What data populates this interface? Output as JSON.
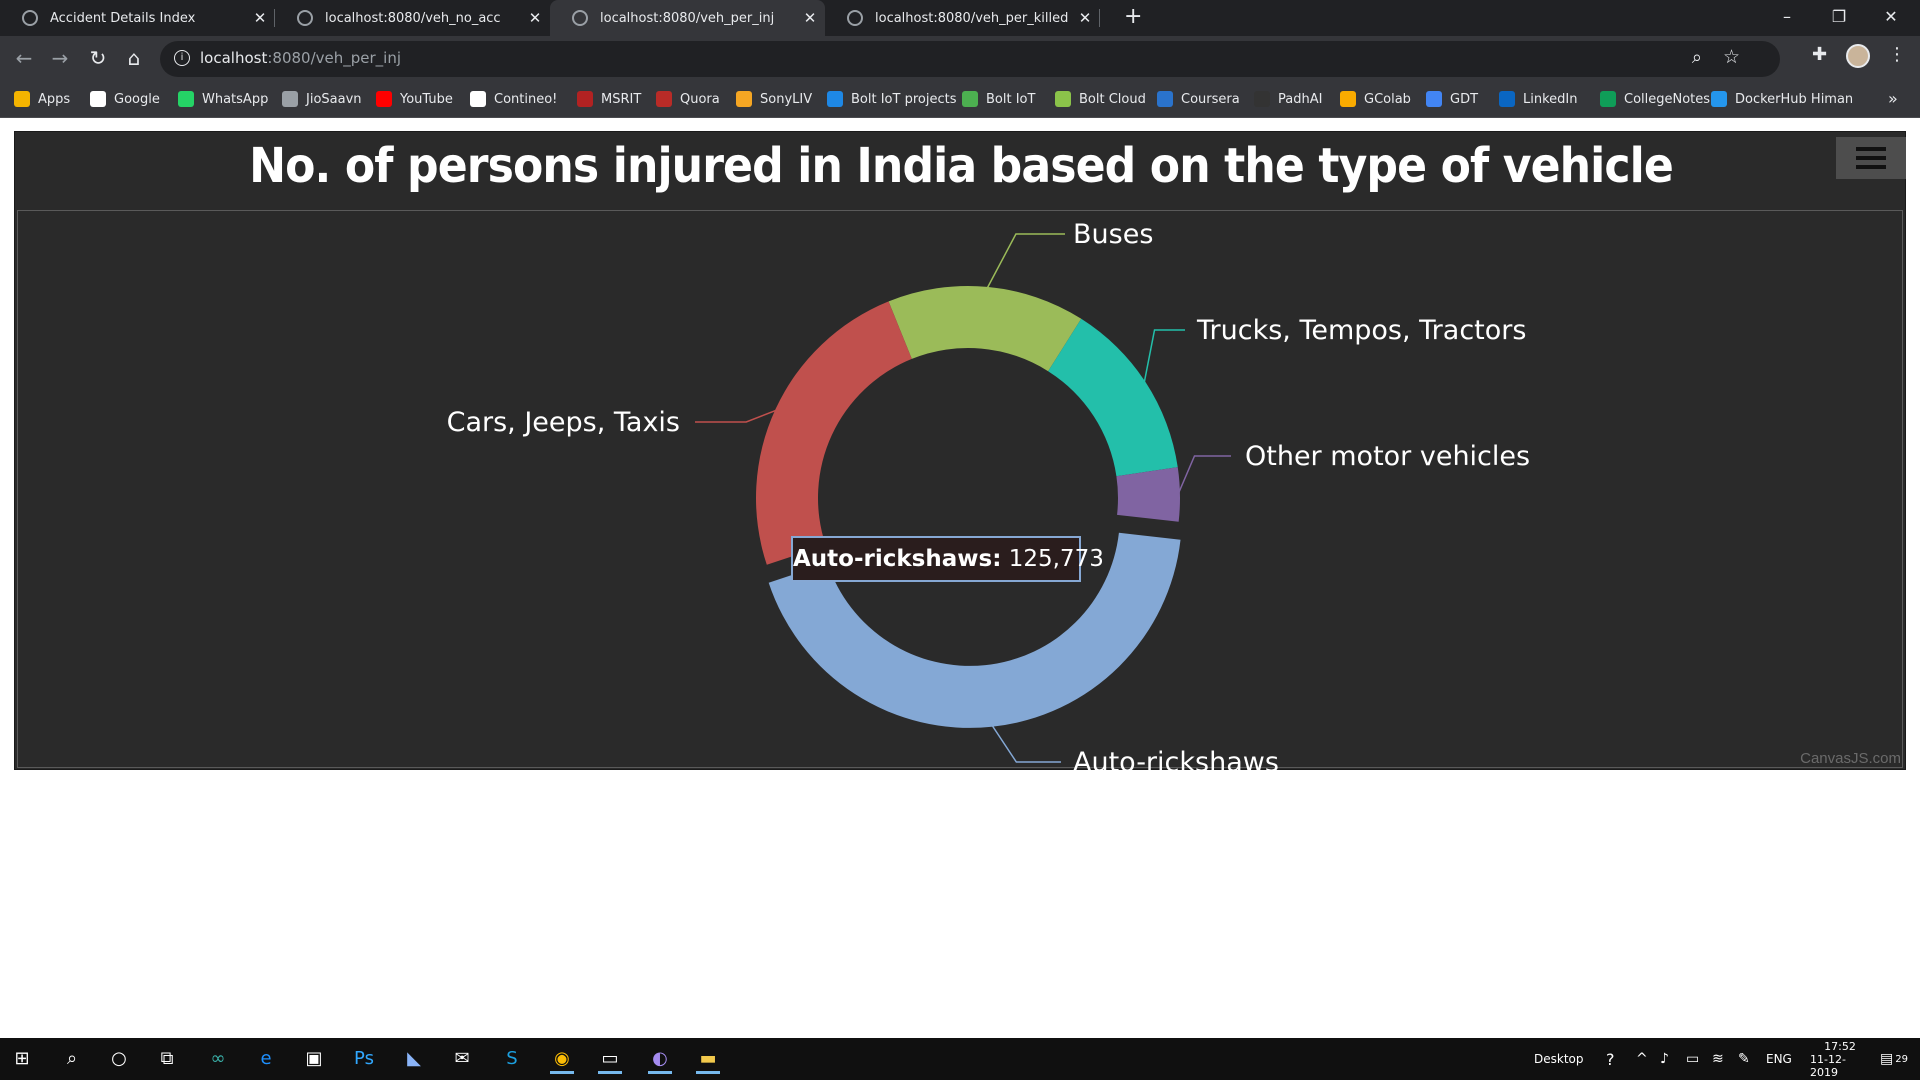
{
  "browser": {
    "tabs": [
      {
        "label": "Accident Details Index",
        "active": false
      },
      {
        "label": "localhost:8080/veh_no_acc",
        "active": false
      },
      {
        "label": "localhost:8080/veh_per_inj",
        "active": true
      },
      {
        "label": "localhost:8080/veh_per_killed",
        "active": false
      }
    ],
    "new_tab": "+",
    "url_host": "localhost",
    "url_rest": ":8080/veh_per_inj",
    "bookmarks": [
      {
        "label": "Apps",
        "color": "#f4b400"
      },
      {
        "label": "Google",
        "color": "#ffffff"
      },
      {
        "label": "WhatsApp",
        "color": "#25d366"
      },
      {
        "label": "JioSaavn",
        "color": "#9aa0a6"
      },
      {
        "label": "YouTube",
        "color": "#ff0000"
      },
      {
        "label": "Contineo!",
        "color": "#ffffff"
      },
      {
        "label": "MSRIT",
        "color": "#b22222"
      },
      {
        "label": "Quora",
        "color": "#b92b27"
      },
      {
        "label": "SonyLIV",
        "color": "#f5a623"
      },
      {
        "label": "Bolt IoT projects",
        "color": "#1e88e5"
      },
      {
        "label": "Bolt IoT",
        "color": "#4caf50"
      },
      {
        "label": "Bolt Cloud",
        "color": "#8bc34a"
      },
      {
        "label": "Coursera",
        "color": "#2a73cc"
      },
      {
        "label": "PadhAI",
        "color": "#333333"
      },
      {
        "label": "GColab",
        "color": "#f9ab00"
      },
      {
        "label": "GDT",
        "color": "#4285f4"
      },
      {
        "label": "LinkedIn",
        "color": "#0a66c2"
      },
      {
        "label": "CollegeNotes",
        "color": "#0f9d58"
      },
      {
        "label": "DockerHub Himan",
        "color": "#2496ed"
      }
    ],
    "bookmarks_more": "»"
  },
  "chart": {
    "credit": "CanvasJS.com",
    "tooltip": {
      "label": "Auto-rickshaws:",
      "value": "125,773"
    }
  },
  "chart_data": {
    "type": "pie",
    "title": "No. of persons injured in India based on the type of vehicle",
    "series": [
      {
        "name": "Buses",
        "value": 44000,
        "color": "#9bbb59"
      },
      {
        "name": "Trucks, Tempos, Tractors",
        "value": 40000,
        "color": "#23bfaa"
      },
      {
        "name": "Other motor vehicles",
        "value": 12000,
        "color": "#8064a2"
      },
      {
        "name": "Auto-rickshaws",
        "value": 125773,
        "color": "#84a8d5"
      },
      {
        "name": "Cars, Jeeps, Taxis",
        "value": 70000,
        "color": "#c0504d"
      }
    ],
    "highlighted": "Auto-rickshaws"
  },
  "taskbar": {
    "desktop": "Desktop",
    "lang": "ENG",
    "time": "17:52",
    "date": "11-12-2019",
    "notifications": "29"
  }
}
